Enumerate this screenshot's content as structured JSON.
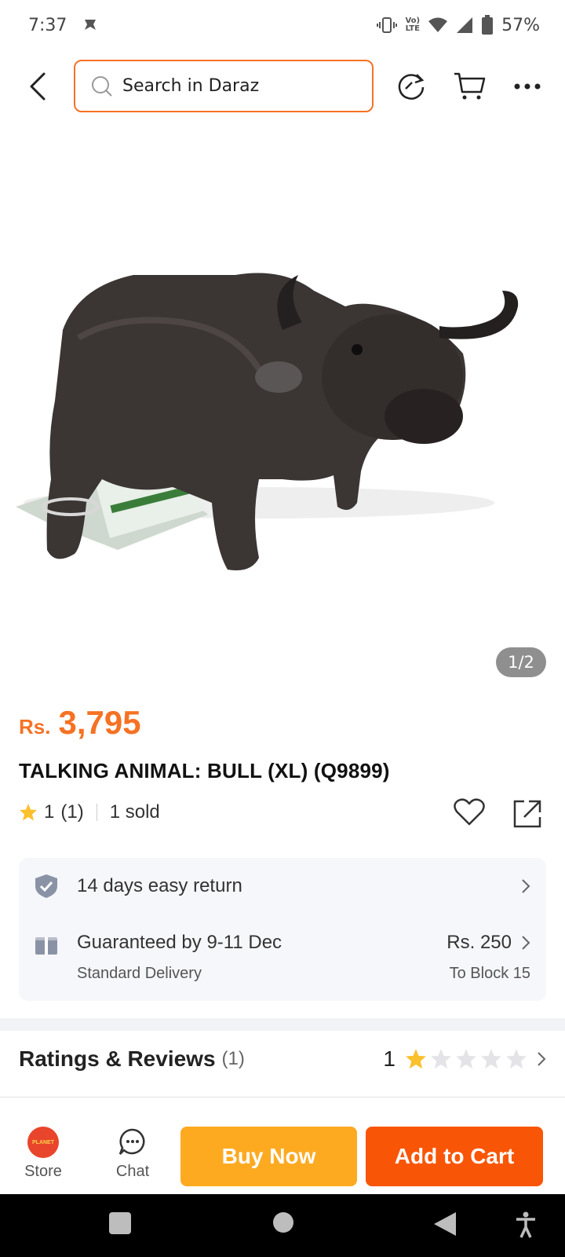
{
  "status_bar": {
    "time": "7:37",
    "battery": "57%",
    "network_label": "LTE"
  },
  "top_bar": {
    "search_placeholder": "Search in Daraz",
    "icons": [
      "back-arrow-icon",
      "refresh-icon",
      "cart-icon",
      "more-icon"
    ]
  },
  "gallery": {
    "counter": "1/2",
    "alt": "TALKING ANIMAL: BULL"
  },
  "product": {
    "currency": "Rs.",
    "price": "3,795",
    "title": "TALKING ANIMAL: BULL (XL) (Q9899)",
    "rating": "1",
    "rating_count": "(1)",
    "sold": "1 sold"
  },
  "info": {
    "return_text": "14 days easy return",
    "delivery_title": "Guaranteed by 9-11 Dec",
    "delivery_type": "Standard Delivery",
    "delivery_fee": "Rs. 250",
    "delivery_to": "To Block 15"
  },
  "ratings": {
    "heading": "Ratings & Reviews",
    "count": "(1)",
    "score": "1",
    "stars_filled": 1,
    "stars_total": 5
  },
  "bottom_bar": {
    "store_label": "Store",
    "chat_label": "Chat",
    "buy_now": "Buy Now",
    "add_to_cart": "Add to Cart"
  },
  "colors": {
    "accent": "#f57224",
    "buy_now": "#fdaa21",
    "add_to_cart": "#f85606",
    "star": "#fbc02d"
  }
}
